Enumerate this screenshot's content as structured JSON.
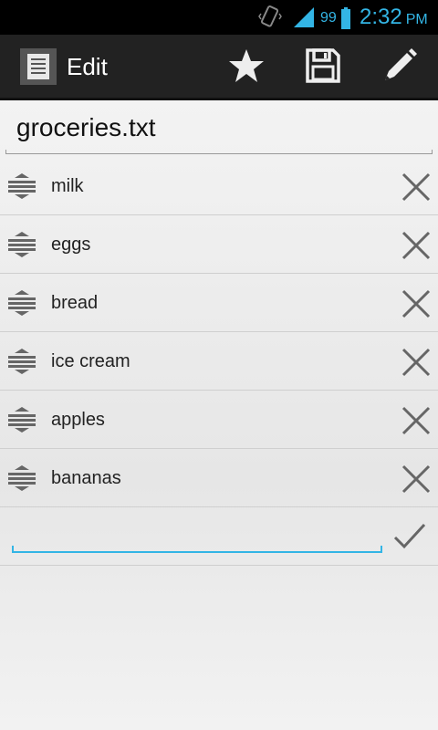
{
  "status_bar": {
    "battery_level": "99",
    "time": "2:32",
    "ampm": "PM",
    "icons": [
      "vibrate-icon",
      "signal-icon",
      "battery-icon"
    ],
    "accent_color": "#33b5e5"
  },
  "action_bar": {
    "title": "Edit",
    "icons": [
      "document-icon",
      "star-icon",
      "save-icon",
      "pencil-icon"
    ]
  },
  "file": {
    "name": "groceries.txt"
  },
  "items": [
    {
      "label": "milk"
    },
    {
      "label": "eggs"
    },
    {
      "label": "bread"
    },
    {
      "label": "ice cream"
    },
    {
      "label": "apples"
    },
    {
      "label": "bananas"
    }
  ],
  "new_item": {
    "value": "",
    "placeholder": ""
  }
}
